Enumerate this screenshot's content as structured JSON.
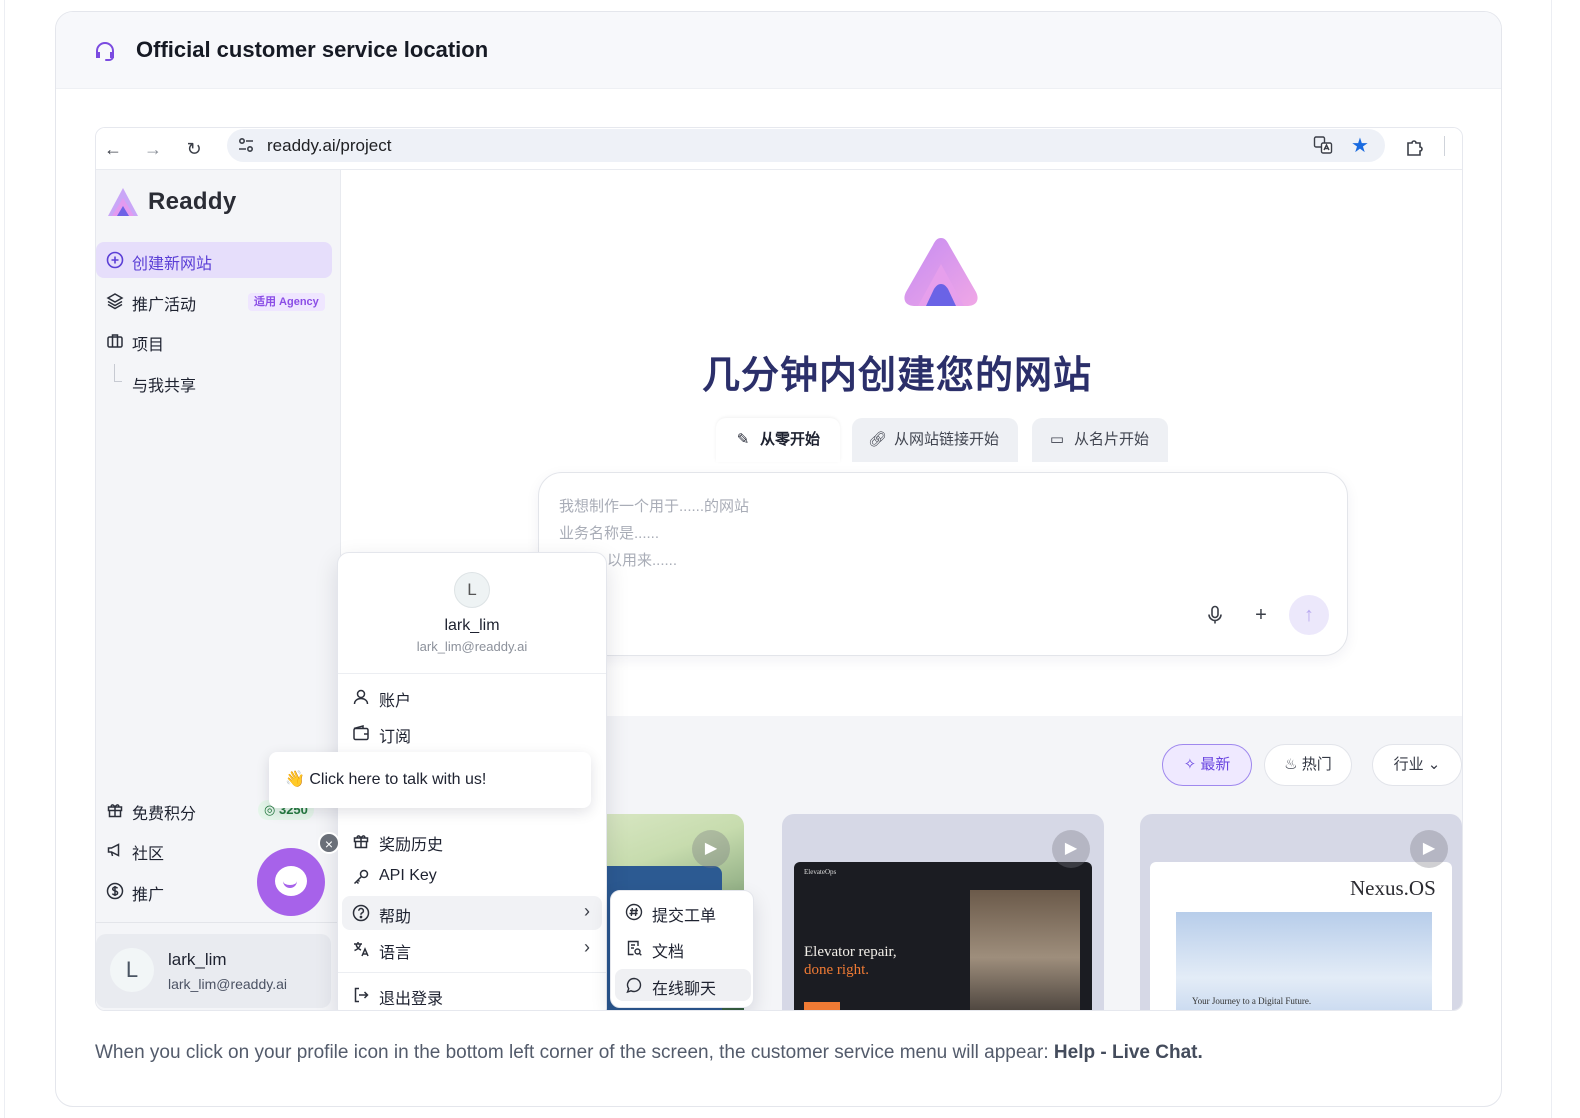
{
  "section": {
    "title": "Official customer service location",
    "caption_text": "When you click on your profile icon in the bottom left corner of the screen, the customer service menu will appear: ",
    "caption_bold": "Help - Live Chat."
  },
  "browser": {
    "url": "readdy.ai/project"
  },
  "sidebar": {
    "brand": "Readdy",
    "items": [
      {
        "label": "创建新网站",
        "icon": "plus-circle-icon"
      },
      {
        "label": "推广活动",
        "icon": "layers-icon",
        "badge": "适用 Agency"
      },
      {
        "label": "项目",
        "icon": "briefcase-icon"
      },
      {
        "label": "与我共享",
        "icon": ""
      }
    ],
    "bottom_items": [
      {
        "label": "免费积分",
        "icon": "gift-icon",
        "badge": "3250"
      },
      {
        "label": "社区",
        "icon": "megaphone-icon"
      },
      {
        "label": "推广",
        "icon": "dollar-circle-icon"
      }
    ],
    "user": {
      "initial": "L",
      "name": "lark_lim",
      "email": "lark_lim@readdy.ai"
    }
  },
  "main": {
    "headline": "几分钟内创建您的网站",
    "tabs": [
      {
        "label": "从零开始",
        "icon": "pencil-icon"
      },
      {
        "label": "从网站链接开始",
        "icon": "link-icon"
      },
      {
        "label": "从名片开始",
        "icon": "id-card-icon"
      }
    ],
    "prompt_lines": [
      "我想制作一个用于......的网站",
      "业务名称是......",
      "以用来......"
    ],
    "filters": [
      {
        "label": "最新",
        "icon": "sparkle-icon"
      },
      {
        "label": "热门",
        "icon": "flame-icon"
      },
      {
        "label": "行业",
        "icon": "chevron-down-icon"
      }
    ],
    "thumbs": [
      {
        "headline": "Elevator repair,",
        "headline2": "done right.",
        "brand": "ElevateOps"
      },
      {
        "headline": "Nexus.OS",
        "subtitle": "Your Journey to a Digital Future."
      }
    ]
  },
  "profile_menu": {
    "initial": "L",
    "name": "lark_lim",
    "email": "lark_lim@readdy.ai",
    "items": [
      {
        "label": "账户",
        "icon": "user-icon"
      },
      {
        "label": "订阅",
        "icon": "wallet-icon"
      },
      {
        "label": "奖励历史",
        "icon": "gift-icon"
      },
      {
        "label": "API Key",
        "icon": "key-icon"
      },
      {
        "label": "帮助",
        "icon": "help-circle-icon"
      },
      {
        "label": "语言",
        "icon": "translate-icon"
      },
      {
        "label": "退出登录",
        "icon": "logout-icon"
      }
    ],
    "help_submenu": [
      {
        "label": "提交工单",
        "icon": "hash-icon"
      },
      {
        "label": "文档",
        "icon": "document-search-icon"
      },
      {
        "label": "在线聊天",
        "icon": "chat-bubble-icon"
      }
    ]
  },
  "chat_widget": {
    "prompt": "👋 Click here to talk with us!"
  },
  "colors": {
    "accent": "#6a45e0",
    "active_nav_bg": "#e6defb",
    "chat_fab": "#a762ea",
    "headline": "#2b2f6a"
  }
}
